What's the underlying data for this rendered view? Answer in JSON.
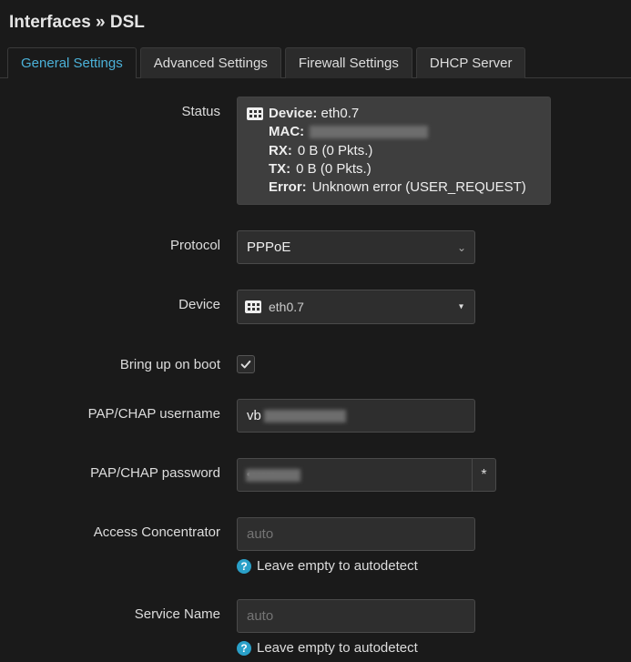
{
  "title": "Interfaces » DSL",
  "tabs": [
    {
      "label": "General Settings",
      "active": true
    },
    {
      "label": "Advanced Settings",
      "active": false
    },
    {
      "label": "Firewall Settings",
      "active": false
    },
    {
      "label": "DHCP Server",
      "active": false
    }
  ],
  "status": {
    "label": "Status",
    "device_k": "Device:",
    "device_v": "eth0.7",
    "mac_k": "MAC:",
    "mac_v": "",
    "rx_k": "RX:",
    "rx_v": "0 B (0 Pkts.)",
    "tx_k": "TX:",
    "tx_v": "0 B (0 Pkts.)",
    "err_k": "Error:",
    "err_v": "Unknown error (USER_REQUEST)"
  },
  "protocol": {
    "label": "Protocol",
    "value": "PPPoE"
  },
  "device": {
    "label": "Device",
    "value": "eth0.7"
  },
  "bring_up": {
    "label": "Bring up on boot",
    "checked": true
  },
  "username": {
    "label": "PAP/CHAP username",
    "value": "vb"
  },
  "password": {
    "label": "PAP/CHAP password",
    "value": "••••••",
    "toggle": "*"
  },
  "ac": {
    "label": "Access Concentrator",
    "value": "",
    "placeholder": "auto",
    "hint": "Leave empty to autodetect"
  },
  "svc": {
    "label": "Service Name",
    "value": "",
    "placeholder": "auto",
    "hint": "Leave empty to autodetect"
  }
}
